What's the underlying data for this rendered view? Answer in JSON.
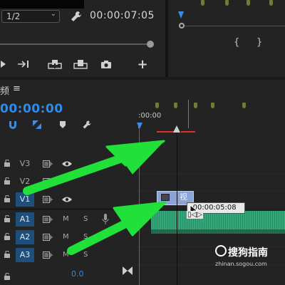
{
  "source_monitor": {
    "zoom_value": "1/2",
    "timecode": "00:00:07:05"
  },
  "timeline": {
    "tab_label": "频",
    "menu_glyph": "≡",
    "timecode": "00:00:00",
    "ruler_start": ":00:00",
    "tracks": [
      {
        "name": "V3",
        "type": "video"
      },
      {
        "name": "V2",
        "type": "video"
      },
      {
        "name": "V1",
        "type": "video"
      },
      {
        "name": "A1",
        "type": "audio",
        "m": "M",
        "s": "S"
      },
      {
        "name": "A2",
        "type": "audio",
        "m": "M",
        "s": "S"
      },
      {
        "name": "A3",
        "type": "audio",
        "m": "M",
        "s": "S"
      }
    ],
    "video_clip_label": "视",
    "tooltip": "-00:00:05:08",
    "footer_value": "0.0"
  },
  "program_monitor": {
    "brace_left": "{",
    "brace_right": "}"
  },
  "watermark": {
    "name": "搜狗指南",
    "url": "zhinan.sogou.com"
  },
  "colors": {
    "accent_blue": "#2d8ceb",
    "arrow_green": "#22e03a",
    "work_area_red": "#e03030",
    "audio_clip": "#2b9a70",
    "video_clip": "#8aa4d6"
  },
  "icons": [
    "chevron-down-icon",
    "wrench-icon",
    "play-icon",
    "step-forward-icon",
    "insert-icon",
    "overwrite-icon",
    "camera-icon",
    "plus-icon",
    "magnet-icon",
    "linked-selection-icon",
    "marker-icon",
    "lock-icon",
    "sync-lock-icon",
    "eye-icon",
    "mic-icon",
    "bowtie-icon",
    "razor-cursor-icon"
  ]
}
